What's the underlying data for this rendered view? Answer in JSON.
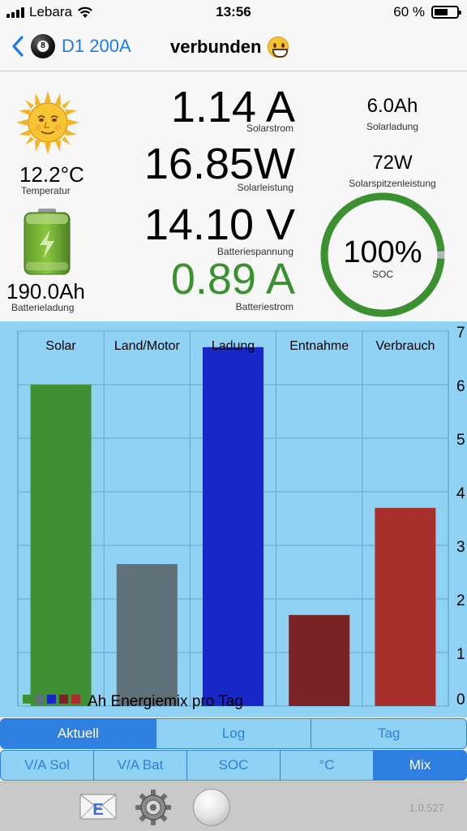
{
  "status_bar": {
    "carrier": "Lebara",
    "time": "13:56",
    "battery_percent": "60 %",
    "battery_level": 0.6
  },
  "nav": {
    "device_name": "D1 200A",
    "connection_status": "verbunden",
    "back_icon": "chevron-left-icon",
    "device_icon": "billiard-8-ball-icon",
    "status_icon": "grinning-face-icon"
  },
  "readings": {
    "temperature": {
      "value": "12.2°C",
      "label": "Temperatur"
    },
    "battery_charge": {
      "value": "190.0Ah",
      "label": "Batterieladung"
    },
    "solar_current": {
      "value": "1.14 A",
      "label": "Solarstrom"
    },
    "solar_power": {
      "value": "16.85W",
      "label": "Solarleistung"
    },
    "battery_voltage": {
      "value": "14.10 V",
      "label": "Batteriespannung"
    },
    "battery_current": {
      "value": "0.89 A",
      "label": "Batteriestrom"
    },
    "solar_charge": {
      "value": "6.0Ah",
      "label": "Solarladung"
    },
    "solar_peak_power": {
      "value": "72W",
      "label": "Solarspitzenleistung"
    },
    "soc": {
      "value": "100%",
      "label": "SOC",
      "fraction": 0.98
    }
  },
  "chart_data": {
    "type": "bar",
    "categories": [
      "Solar",
      "Land/Motor",
      "Ladung",
      "Entnahme",
      "Verbrauch"
    ],
    "values": [
      6.0,
      2.65,
      6.7,
      1.7,
      3.7
    ],
    "colors": [
      "#3f8f33",
      "#607078",
      "#1828c8",
      "#7a2326",
      "#a8302c"
    ],
    "yticks": [
      "0",
      "1",
      "2",
      "3",
      "4",
      "5",
      "6",
      "7"
    ],
    "ylim": [
      0,
      7
    ],
    "legend": "Ah Energiemix pro Tag",
    "legend_position": "bottom-left",
    "grid": true,
    "background": "#8fd2f4"
  },
  "tabs_row1": [
    {
      "label": "Aktuell",
      "active": true
    },
    {
      "label": "Log",
      "active": false
    },
    {
      "label": "Tag",
      "active": false
    }
  ],
  "tabs_row2": [
    {
      "label": "V/A Sol",
      "active": false
    },
    {
      "label": "V/A Bat",
      "active": false
    },
    {
      "label": "SOC",
      "active": false
    },
    {
      "label": "°C",
      "active": false
    },
    {
      "label": "Mix",
      "active": true
    }
  ],
  "toolbar": {
    "mail_icon": "mail-icon",
    "mail_letter": "E",
    "settings_icon": "gear-icon",
    "status_icon": "status-ball-icon",
    "version": "1.0.527"
  },
  "colors": {
    "accent": "#2f7fe0",
    "value_green": "#3b9130",
    "soc_ring": "#3b9130"
  }
}
